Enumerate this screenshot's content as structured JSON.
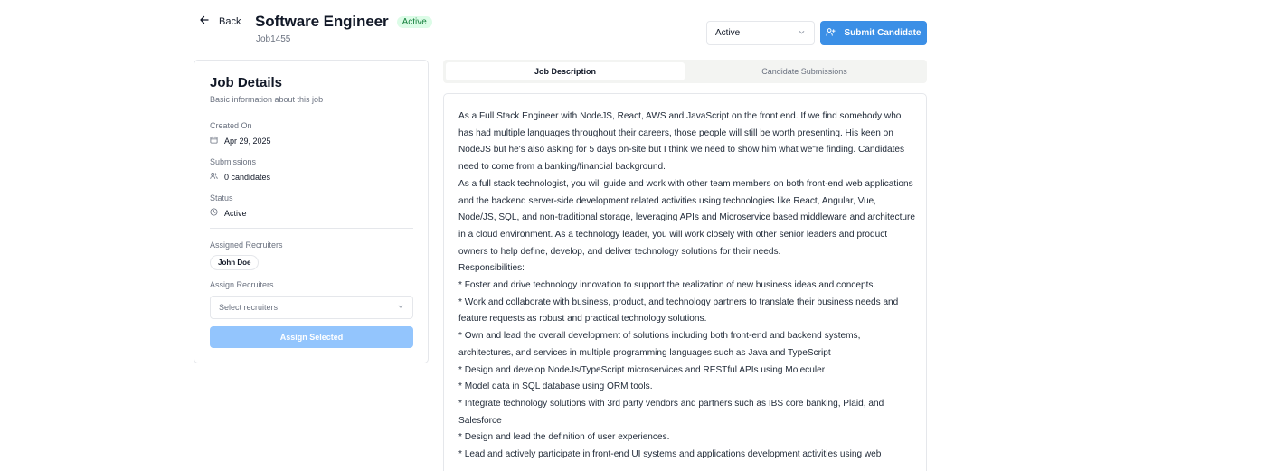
{
  "header": {
    "back_label": "Back",
    "job_title": "Software Engineer",
    "status_badge": "Active",
    "job_id": "Job1455",
    "status_select_value": "Active",
    "submit_label": "Submit Candidate"
  },
  "details": {
    "title": "Job Details",
    "subtitle": "Basic information about this job",
    "created_label": "Created On",
    "created_value": "Apr 29, 2025",
    "submissions_label": "Submissions",
    "submissions_value": "0 candidates",
    "status_label": "Status",
    "status_value": "Active",
    "assigned_label": "Assigned Recruiters",
    "assigned_recruiter": "John Doe",
    "assign_label": "Assign Recruiters",
    "select_placeholder": "Select recruiters",
    "assign_button": "Assign Selected"
  },
  "tabs": {
    "description": "Job Description",
    "submissions": "Candidate Submissions"
  },
  "description": [
    "As a Full Stack Engineer with NodeJS, React, AWS and JavaScript on the front end. If we find somebody who has had multiple languages throughout their careers, those people will still be worth presenting. His keen on NodeJS but he's also asking for 5 days on-site but I think we need to show him what we\"re finding. Candidates need to come from a banking/financial background.",
    "As a full stack technologist, you will guide and work with other team members on both front-end web applications and the backend server-side development related activities using technologies like React, Angular, Vue, Node/JS, SQL, and non-traditional storage, leveraging APIs and Microservice based middleware and architecture in a cloud environment. As a technology leader, you will work closely with other senior leaders and product owners to help define, develop, and deliver technology solutions for their needs.",
    "Responsibilities:",
    "* Foster and drive technology innovation to support the realization of new business ideas and concepts.",
    "* Work and collaborate with business, product, and technology partners to translate their business needs and feature requests as robust and practical technology solutions.",
    "* Own and lead the overall development of solutions including both front-end and backend systems, architectures, and services in multiple programming languages such as Java and TypeScript",
    "* Design and develop NodeJs/TypeScript microservices and RESTful APIs using Moleculer",
    "* Model data in SQL database using ORM tools.",
    "* Integrate technology solutions with 3rd party vendors and partners such as IBS core banking, Plaid, and Salesforce",
    "* Design and lead the definition of user experiences.",
    "* Lead and actively participate in front-end UI systems and applications development activities using web"
  ]
}
